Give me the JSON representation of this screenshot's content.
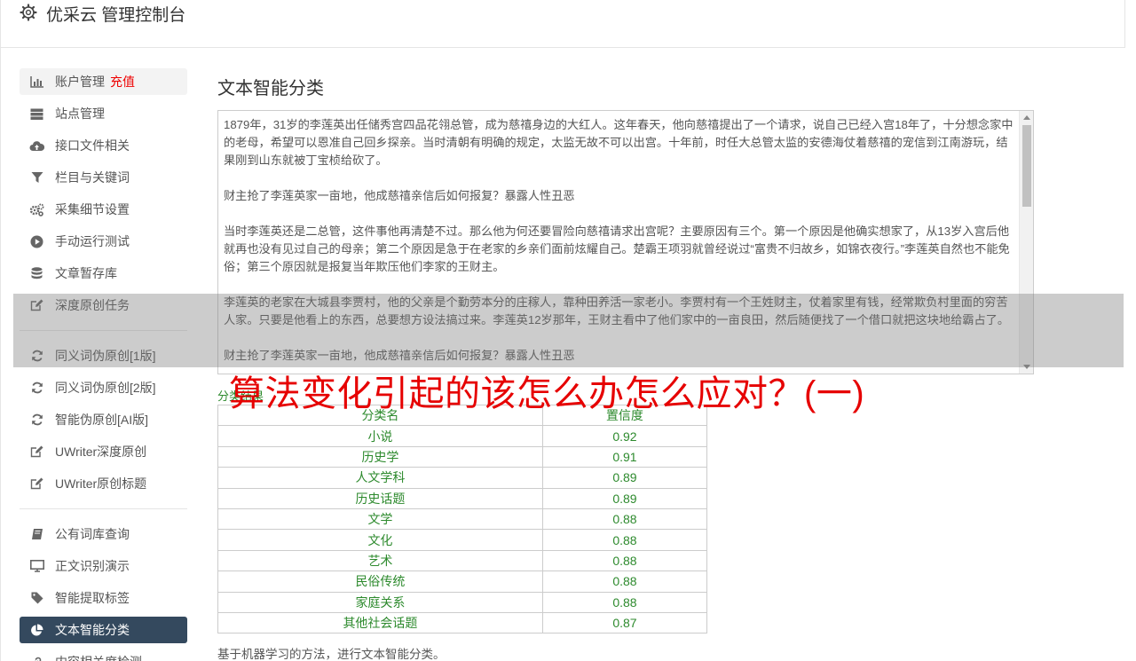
{
  "header": {
    "title": "优采云 管理控制台",
    "icon": "gear-icon"
  },
  "sidebar": {
    "group1": [
      {
        "label": "账户管理",
        "badge": "充值",
        "icon": "bar-chart-icon"
      },
      {
        "label": "站点管理",
        "icon": "server-icon"
      },
      {
        "label": "接口文件相关",
        "icon": "cloud-upload-icon"
      },
      {
        "label": "栏目与关键词",
        "icon": "filter-icon"
      },
      {
        "label": "采集细节设置",
        "icon": "gears-icon"
      },
      {
        "label": "手动运行测试",
        "icon": "play-circle-icon"
      },
      {
        "label": "文章暂存库",
        "icon": "database-icon"
      },
      {
        "label": "深度原创任务",
        "icon": "edit-icon"
      }
    ],
    "group2": [
      {
        "label": "同义词伪原创[1版]",
        "icon": "refresh-icon"
      },
      {
        "label": "同义词伪原创[2版]",
        "icon": "refresh-icon"
      },
      {
        "label": "智能伪原创[AI版]",
        "icon": "refresh-icon"
      },
      {
        "label": "UWriter深度原创",
        "icon": "edit-icon"
      },
      {
        "label": "UWriter原创标题",
        "icon": "edit-icon"
      }
    ],
    "group3": [
      {
        "label": "公有词库查询",
        "icon": "book-icon"
      },
      {
        "label": "正文识别演示",
        "icon": "monitor-icon"
      },
      {
        "label": "智能提取标签",
        "icon": "tag-icon"
      },
      {
        "label": "文本智能分类",
        "icon": "pie-chart-icon"
      },
      {
        "label": "内容相关度检测",
        "icon": "link-icon"
      }
    ]
  },
  "main": {
    "title": "文本智能分类",
    "text_paragraphs": [
      "1879年，31岁的李莲英出任储秀宫四品花翎总管，成为慈禧身边的大红人。这年春天，他向慈禧提出了一个请求，说自己已经入宫18年了，十分想念家中的老母，希望可以恩准自己回乡探亲。当时清朝有明确的规定，太监无故不可以出宫。十年前，时任大总管太监的安德海仗着慈禧的宠信到江南游玩，结果刚到山东就被丁宝桢给砍了。",
      "财主抢了李莲英家一亩地，他成慈禧亲信后如何报复？暴露人性丑恶",
      "当时李莲英还是二总管，这件事他再清楚不过。那么他为何还要冒险向慈禧请求出宫呢？主要原因有三个。第一个原因是他确实想家了，从13岁入宫后他就再也没有见过自己的母亲；第二个原因是急于在老家的乡亲们面前炫耀自己。楚霸王项羽就曾经说过“富贵不归故乡，如锦衣夜行。”李莲英自然也不能免俗；第三个原因就是报复当年欺压他们李家的王财主。",
      "李莲英的老家在大城县李贾村，他的父亲是个勤劳本分的庄稼人，靠种田养活一家老小。李贾村有一个王姓财主，仗着家里有钱，经常欺负村里面的穷苦人家。只要是他看上的东西，总要想方设法搞过来。李莲英12岁那年，王财主看中了他们家中的一亩良田，然后随便找了一个借口就把这块地给霸占了。",
      "财主抢了李莲英家一亩地，他成慈禧亲信后如何报复？暴露人性丑恶"
    ],
    "overlay_banner": "算法变化引起的该怎么办怎么应对？(一)",
    "result_label": "分类结果",
    "table": {
      "headers": [
        "分类名",
        "置信度"
      ],
      "rows": [
        [
          "小说",
          "0.92"
        ],
        [
          "历史学",
          "0.91"
        ],
        [
          "人文学科",
          "0.89"
        ],
        [
          "历史话题",
          "0.89"
        ],
        [
          "文学",
          "0.88"
        ],
        [
          "文化",
          "0.88"
        ],
        [
          "艺术",
          "0.88"
        ],
        [
          "民俗传统",
          "0.88"
        ],
        [
          "家庭关系",
          "0.88"
        ],
        [
          "其他社会话题",
          "0.87"
        ]
      ]
    },
    "footnote": "基于机器学习的方法，进行文本智能分类。"
  },
  "colors": {
    "active_nav": "#34495e",
    "accent_red": "#e60000",
    "result_green": "#2d8a2d"
  }
}
